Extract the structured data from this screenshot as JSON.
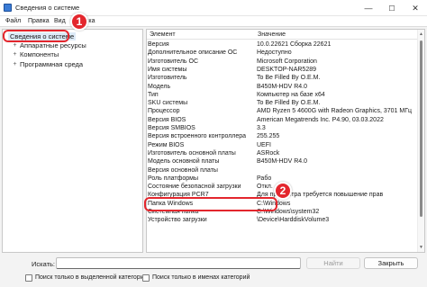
{
  "window": {
    "title": "Сведения о системе",
    "minimize": "—",
    "maximize": "☐",
    "close": "✕"
  },
  "menu": [
    "Файл",
    "Правка",
    "Вид",
    "Справка"
  ],
  "tree": {
    "items": [
      {
        "label": "Сведения о системе",
        "expander": ""
      },
      {
        "label": "Аппаратные ресурсы",
        "expander": "+"
      },
      {
        "label": "Компоненты",
        "expander": "+"
      },
      {
        "label": "Программная среда",
        "expander": "+"
      }
    ]
  },
  "list": {
    "headers": {
      "key": "Элемент",
      "value": "Значение"
    },
    "rows": [
      {
        "k": "Версия",
        "v": "10.0.22621 Сборка 22621"
      },
      {
        "k": "Дополнительное описание ОС",
        "v": "Недоступно"
      },
      {
        "k": "Изготовитель ОС",
        "v": "Microsoft Corporation"
      },
      {
        "k": "Имя системы",
        "v": "DESKTOP-NAR5289"
      },
      {
        "k": "Изготовитель",
        "v": "To Be Filled By O.E.M."
      },
      {
        "k": "Модель",
        "v": "B450M-HDV R4.0"
      },
      {
        "k": "Тип",
        "v": "Компьютер на базе x64"
      },
      {
        "k": "SKU системы",
        "v": "To Be Filled By O.E.M."
      },
      {
        "k": "Процессор",
        "v": "AMD Ryzen 5 4600G with Radeon Graphics, 3701 МГц"
      },
      {
        "k": "Версия BIOS",
        "v": "American Megatrends Inc. P4.90, 03.03.2022"
      },
      {
        "k": "Версия SMBIOS",
        "v": "3.3"
      },
      {
        "k": "Версия встроенного контроллера",
        "v": "255.255"
      },
      {
        "k": "Режим BIOS",
        "v": "UEFI"
      },
      {
        "k": "Изготовитель основной платы",
        "v": "ASRock"
      },
      {
        "k": "Модель основной платы",
        "v": "B450M-HDV R4.0"
      },
      {
        "k": "Версия основной платы",
        "v": ""
      },
      {
        "k": "Роль платформы",
        "v": "Рабо"
      },
      {
        "k": "Состояние безопасной загрузки",
        "v": "Откл."
      },
      {
        "k": "Конфигурация PCR7",
        "v": "Для просмотра требуется повышение прав"
      },
      {
        "k": "Папка Windows",
        "v": "C:\\Windows"
      },
      {
        "k": "Системная папка",
        "v": "C:\\Windows\\system32"
      },
      {
        "k": "Устройство загрузки",
        "v": "\\Device\\HarddiskVolume3"
      }
    ]
  },
  "annotations": {
    "badge1": "1",
    "badge2": "2",
    "color": "#e3262d"
  },
  "search": {
    "label": "Искать:",
    "value": "",
    "find_button": "Найти",
    "close_button": "Закрыть",
    "checkbox_selected": "Поиск только в выделенной категории",
    "checkbox_names": "Поиск только в именах категорий"
  }
}
